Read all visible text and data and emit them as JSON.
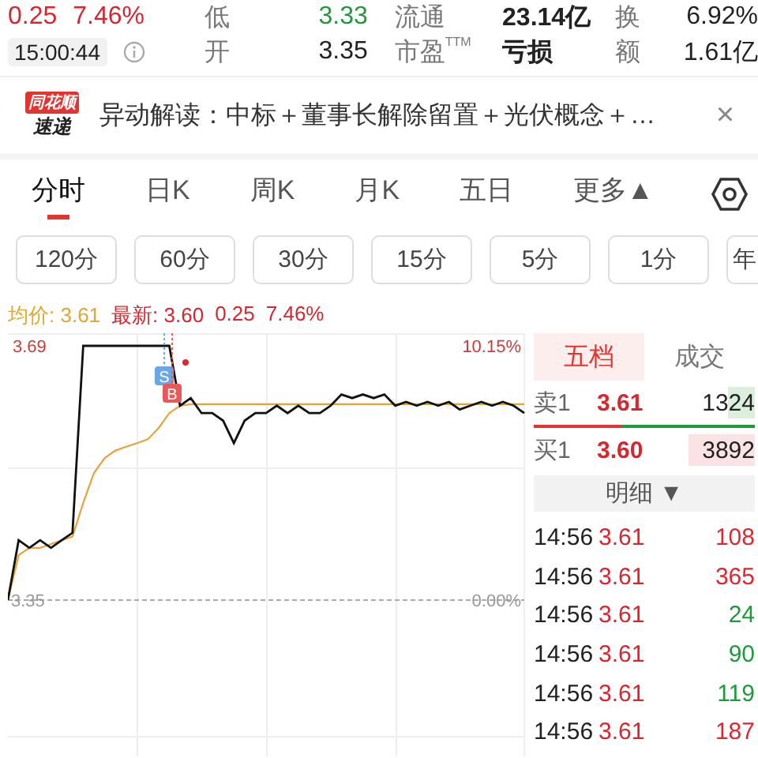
{
  "quote": {
    "change": "0.25",
    "percent": "7.46%",
    "time": "15:00:44",
    "stats": [
      {
        "label": "低",
        "value": "3.33",
        "color": "#1f9a3a"
      },
      {
        "label": "开",
        "value": "3.35",
        "color": "#222222"
      }
    ],
    "stats2": [
      {
        "label": "流通",
        "value": "23.14亿"
      },
      {
        "label": "市盈$^{TTM}$",
        "value": "亏损"
      }
    ],
    "stats3": [
      {
        "label": "换",
        "value": "6.92%"
      },
      {
        "label": "额",
        "value": "1.61亿"
      }
    ]
  },
  "news": {
    "logo": [
      "同花顺",
      "速递"
    ],
    "text": "异动解读：中标＋董事长解除留置＋光伏概念＋…",
    "close": "×"
  },
  "tabs": [
    {
      "label": "分时",
      "selected": true
    },
    {
      "label": "日K",
      "selected": false
    },
    {
      "label": "周K",
      "selected": false
    },
    {
      "label": "月K",
      "selected": false
    },
    {
      "label": "五日",
      "selected": false
    },
    {
      "label": "更多▲",
      "selected": false
    }
  ],
  "periods": [
    "120分",
    "60分",
    "30分",
    "15分",
    "5分",
    "1分",
    "年"
  ],
  "info": {
    "avg_label": "均价: 3.61",
    "latest_label": "最新: 3.60",
    "change": "0.25",
    "percent": "7.46%"
  },
  "chart": {
    "right_ticks": [
      "10.15%",
      "0.00%"
    ],
    "markers": [
      {
        "label": "S",
        "kind": "sell"
      },
      {
        "label": "B",
        "kind": "buy"
      }
    ],
    "chart_data": {
      "type": "line",
      "grid": true,
      "ylim": [
        3.35,
        3.69
      ],
      "yticks": [
        {
          "value": 3.69,
          "label": "3.69"
        },
        {
          "value": 3.35,
          "label": "3.35"
        }
      ],
      "series": [
        {
          "color": "#111111",
          "values": [
            3.35,
            3.43,
            3.42,
            3.43,
            3.42,
            3.43,
            3.44,
            3.69,
            3.69,
            3.69,
            3.69,
            3.69,
            3.69,
            3.69,
            3.69,
            3.69,
            3.61,
            3.62,
            3.6,
            3.6,
            3.59,
            3.56,
            3.59,
            3.6,
            3.6,
            3.61,
            3.6,
            3.61,
            3.6,
            3.6,
            3.61,
            3.625,
            3.62,
            3.625,
            3.62,
            3.625,
            3.61,
            3.615,
            3.61,
            3.615,
            3.61,
            3.615,
            3.605,
            3.61,
            3.615,
            3.61,
            3.615,
            3.61,
            3.6
          ]
        },
        {
          "color": "#e8a23a",
          "values": [
            3.35,
            3.41,
            3.42,
            3.42,
            3.425,
            3.43,
            3.435,
            3.48,
            3.52,
            3.54,
            3.55,
            3.555,
            3.56,
            3.565,
            3.58,
            3.6,
            3.61,
            3.612,
            3.612,
            3.612,
            3.612,
            3.612,
            3.612,
            3.612,
            3.612,
            3.612,
            3.612,
            3.612,
            3.612,
            3.612,
            3.612,
            3.612,
            3.612,
            3.612,
            3.612,
            3.612,
            3.612,
            3.612,
            3.612,
            3.612,
            3.612,
            3.612,
            3.612,
            3.612,
            3.612,
            3.612,
            3.612,
            3.612,
            3.612
          ]
        }
      ]
    }
  },
  "book": {
    "tabs": [
      {
        "label": "五档",
        "selected": true
      },
      {
        "label": "成交",
        "selected": false
      }
    ],
    "levels": [
      {
        "label": "卖1",
        "price": "3.61",
        "volume": "1324",
        "color": "#dcefdc"
      },
      {
        "label": "买1",
        "price": "3.60",
        "volume": "3892",
        "color": "#fbe3e5"
      }
    ],
    "balance": {
      "level": 0.4
    },
    "detail": "明细 ▼",
    "trades": [
      {
        "time": "14:56",
        "price": "3.61",
        "volume": "108",
        "color": "#e0262f"
      },
      {
        "time": "14:56",
        "price": "3.61",
        "volume": "365",
        "color": "#e0262f"
      },
      {
        "time": "14:56",
        "price": "3.61",
        "volume": "24",
        "color": "#1f9a3a"
      },
      {
        "time": "14:56",
        "price": "3.61",
        "volume": "90",
        "color": "#1f9a3a"
      },
      {
        "time": "14:56",
        "price": "3.61",
        "volume": "119",
        "color": "#1f9a3a"
      },
      {
        "time": "14:56",
        "price": "3.61",
        "volume": "187",
        "color": "#e0262f"
      }
    ]
  }
}
